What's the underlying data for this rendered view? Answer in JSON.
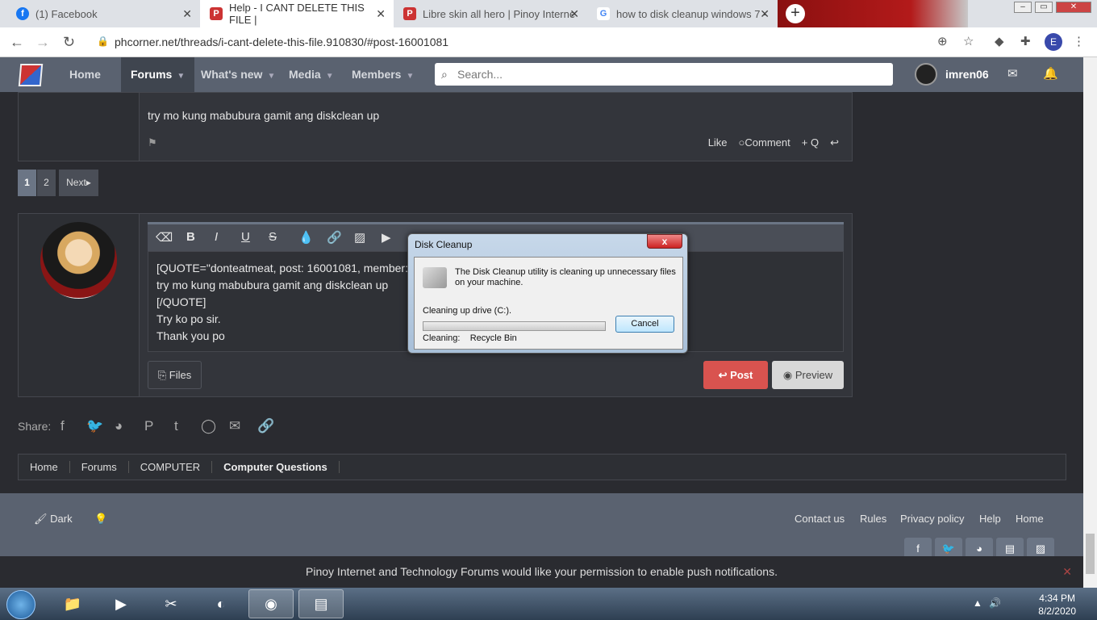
{
  "browser": {
    "tabs": [
      {
        "title": "(1) Facebook",
        "icon": "f"
      },
      {
        "title": "Help - I CANT DELETE THIS FILE |",
        "icon": "P"
      },
      {
        "title": "Libre skin all hero | Pinoy Interne",
        "icon": "P"
      },
      {
        "title": "how to disk cleanup windows 7 -",
        "icon": "G"
      }
    ],
    "url": "phcorner.net/threads/i-cant-delete-this-file.910830/#post-16001081",
    "profile_initial": "E"
  },
  "site_nav": {
    "items": [
      "Home",
      "Forums",
      "What's new",
      "Media",
      "Members"
    ],
    "search_placeholder": "Search...",
    "username": "imren06"
  },
  "post": {
    "text": "try mo kung mabubura gamit ang diskclean up",
    "actions": [
      "Like",
      "Comment",
      "+ Q"
    ]
  },
  "pager": {
    "pages": [
      "1",
      "2"
    ],
    "next": "Next"
  },
  "editor": {
    "lines": [
      "[QUOTE=\"donteatmeat, post: 16001081, member: ",
      "try mo kung mabubura gamit ang diskclean up",
      "[/QUOTE]",
      "Try ko po sir.",
      "Thank you po"
    ],
    "files_label": "Files",
    "post_label": "Post",
    "preview_label": "Preview"
  },
  "share": {
    "label": "Share:"
  },
  "breadcrumb": [
    "Home",
    "Forums",
    "COMPUTER",
    "Computer Questions"
  ],
  "footer": {
    "theme_label": "Dark",
    "links": [
      "Contact us",
      "Rules",
      "Privacy policy",
      "Help",
      "Home"
    ]
  },
  "notification": {
    "text": "Pinoy Internet and Technology Forums would like your permission to enable push notifications."
  },
  "dialog": {
    "title": "Disk Cleanup",
    "close": "x",
    "message": "The Disk Cleanup utility is cleaning up unnecessary files on your machine.",
    "status": "Cleaning up drive  (C:).",
    "cancel_label": "Cancel",
    "cleaning_label": "Cleaning:",
    "cleaning_item": "Recycle Bin"
  },
  "taskbar": {
    "time": "4:34 PM",
    "date": "8/2/2020"
  }
}
